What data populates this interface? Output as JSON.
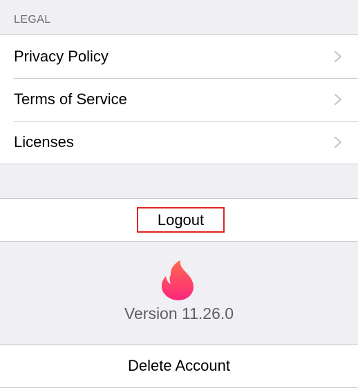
{
  "legal": {
    "header": "LEGAL",
    "items": [
      {
        "label": "Privacy Policy"
      },
      {
        "label": "Terms of Service"
      },
      {
        "label": "Licenses"
      }
    ]
  },
  "logout": {
    "label": "Logout"
  },
  "app": {
    "logo_icon": "tinder-flame-icon",
    "version": "Version 11.26.0",
    "brand_color_top": "#ff6a4d",
    "brand_color_bottom": "#fd267d"
  },
  "delete_account": {
    "label": "Delete Account"
  },
  "colors": {
    "background": "#efeff4",
    "separator": "#c8c7cc",
    "highlight_box": "#e0241b"
  }
}
